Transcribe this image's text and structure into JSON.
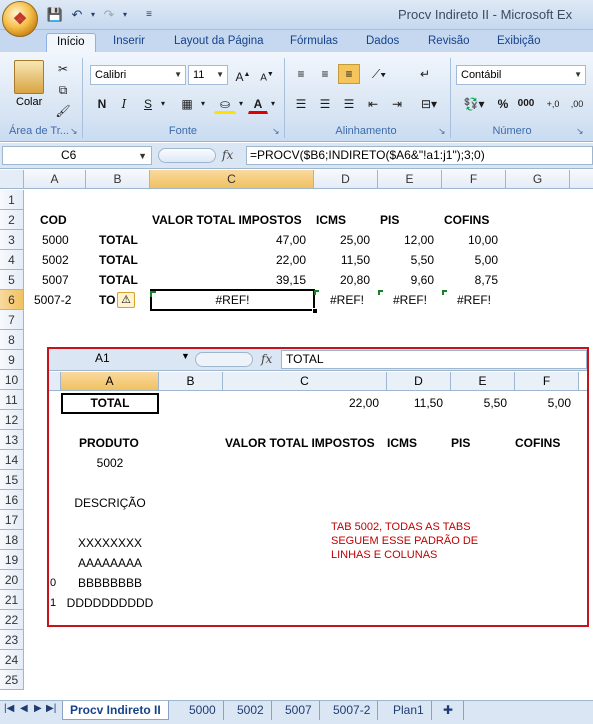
{
  "window": {
    "title": "Procv Indireto II - Microsoft Ex"
  },
  "ribbon": {
    "tabs": [
      "Início",
      "Inserir",
      "Layout da Página",
      "Fórmulas",
      "Dados",
      "Revisão",
      "Exibição"
    ],
    "clipboard": {
      "paste_label": "Colar",
      "group_label": "Área de Tr..."
    },
    "font": {
      "name": "Calibri",
      "size": "11",
      "group_label": "Fonte"
    },
    "alignment": {
      "group_label": "Alinhamento"
    },
    "number": {
      "format": "Contábil",
      "percent": "%",
      "thousands": "000",
      "group_label": "Número"
    }
  },
  "formula_bar": {
    "name_box": "C6",
    "fx": "fx",
    "formula": "=PROCV($B6;INDIRETO($A6&\"!a1:j1\");3;0)"
  },
  "columns": [
    "A",
    "B",
    "C",
    "D",
    "E",
    "F",
    "G"
  ],
  "rows": [
    "1",
    "2",
    "3",
    "4",
    "5",
    "6",
    "7",
    "8",
    "9",
    "10",
    "11",
    "12",
    "13",
    "14",
    "15",
    "16",
    "17",
    "18",
    "19",
    "20",
    "21",
    "22",
    "23",
    "24",
    "25"
  ],
  "cells": {
    "A2": "COD",
    "C2": "VALOR TOTAL IMPOSTOS",
    "D2": "ICMS",
    "E2": "PIS",
    "F2": "COFINS",
    "A3": "5000",
    "B3": "TOTAL",
    "C3": "47,00",
    "D3": "25,00",
    "E3": "12,00",
    "F3": "10,00",
    "A4": "5002",
    "B4": "TOTAL",
    "C4": "22,00",
    "D4": "11,50",
    "E4": "5,50",
    "F4": "5,00",
    "A5": "5007",
    "B5": "TOTAL",
    "C5": "39,15",
    "D5": "20,80",
    "E5": "9,60",
    "F5": "8,75",
    "A6": "5007-2",
    "B6": "TO",
    "C6": "#REF!",
    "D6": "#REF!",
    "E6": "#REF!",
    "F6": "#REF!"
  },
  "embedded": {
    "name_box": "A1",
    "fx": "fx",
    "formula": "TOTAL",
    "columns": [
      "A",
      "B",
      "C",
      "D",
      "E",
      "F"
    ],
    "rows": [
      "10",
      "11",
      "12",
      "13",
      "14",
      "15",
      "16",
      "17",
      "18",
      "19",
      "20",
      "21",
      "22"
    ],
    "partial_row_labels": [
      "0",
      "1"
    ],
    "cells": {
      "A11": "TOTAL",
      "C11": "22,00",
      "D11": "11,50",
      "E11": "5,50",
      "F11": "5,00",
      "A13": "PRODUTO",
      "C13": "VALOR TOTAL IMPOSTOS",
      "D13": "ICMS",
      "E13": "PIS",
      "F13": "COFINS",
      "A14": "5002",
      "A16": "DESCRIÇÃO",
      "A18": "XXXXXXXX",
      "A19": "AAAAAAAA",
      "A20": "BBBBBBBB",
      "A21": "DDDDDDDDDD"
    },
    "note": [
      "TAB 5002, TODAS AS TABS",
      "SEGUEM ESSE PADRÃO DE",
      "LINHAS E COLUNAS"
    ]
  },
  "sheet_tabs": [
    "Procv Indireto II",
    "5000",
    "5002",
    "5007",
    "5007-2",
    "Plan1"
  ],
  "active_sheet": "Procv Indireto II",
  "colors": {
    "selection": "#f1c15f",
    "error_marker": "#1a7f2a",
    "annotation": "#c00000",
    "ribbon_text": "#15428b"
  }
}
